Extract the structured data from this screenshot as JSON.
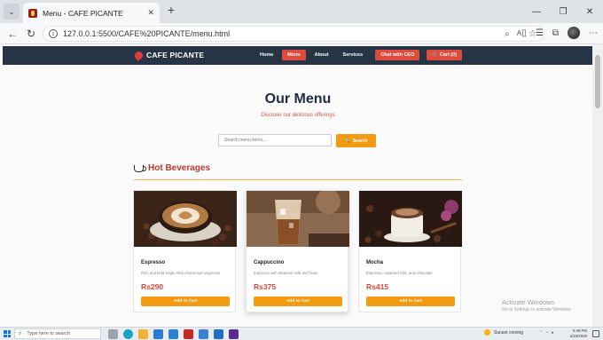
{
  "browser": {
    "tab_title": "Menu - CAFE PICANTE",
    "tab_close": "✕",
    "new_tab": "+",
    "url": "127.0.0.1:5500/CAFE%20PICANTE/menu.html",
    "window_controls": [
      "—",
      "❐",
      "✕"
    ]
  },
  "site": {
    "logo": "CAFE PICANTE",
    "nav": {
      "home": "Home",
      "menu": "Menu",
      "about": "About",
      "services": "Services",
      "chat": "Chat with CEO",
      "cart": "Cart (0)"
    },
    "title": "Our Menu",
    "subtitle": "Discover our delicious offerings",
    "search": {
      "placeholder": "Search menu items...",
      "button": "Search"
    },
    "section": "Hot Beverages",
    "items": [
      {
        "name": "Espresso",
        "desc": "Rich and bold single shot of premium espresso",
        "price": "Rs290",
        "button": "Add to Cart"
      },
      {
        "name": "Cappuccino",
        "desc": "Espresso with steamed milk and foam",
        "price": "Rs375",
        "button": "Add to Cart"
      },
      {
        "name": "Mocha",
        "desc": "Espresso, steamed milk, and chocolate",
        "price": "Rs415",
        "button": "Add to Cart"
      }
    ]
  },
  "watermark": {
    "line1": "Activate Windows",
    "line2": "Go to Settings to activate Windows."
  },
  "taskbar": {
    "search_placeholder": "Type here to search",
    "weather": "Sunset coming",
    "time": "5:48 PM",
    "date": "2/23/2026"
  },
  "colors": {
    "nav_bg": "#263445",
    "accent_red": "#e04b3e",
    "accent_orange": "#f29a12",
    "title": "#1f2a44"
  }
}
